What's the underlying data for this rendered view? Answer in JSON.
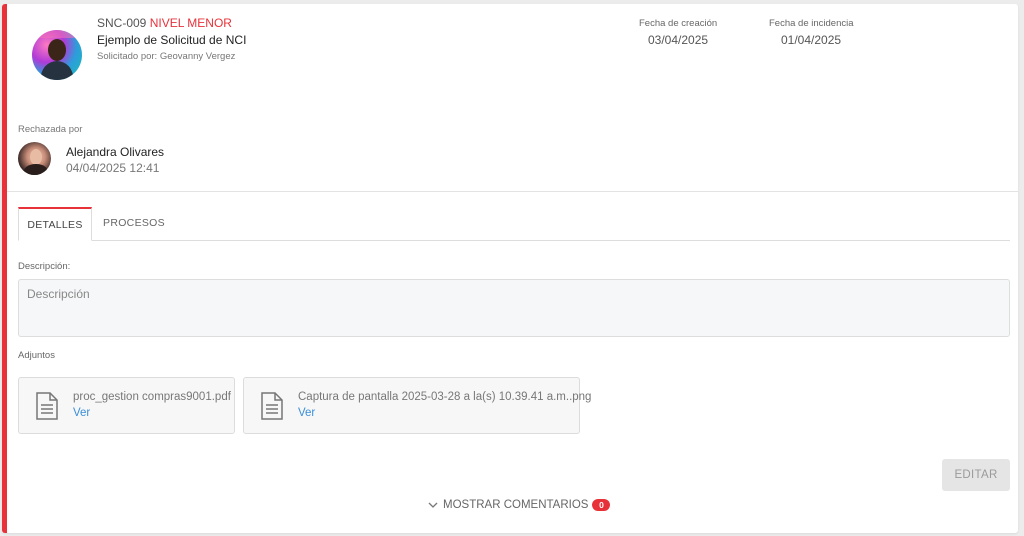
{
  "request": {
    "code": "SNC-009",
    "level": "NIVEL MENOR",
    "title": "Ejemplo de Solicitud de NCI",
    "requested_by": "Solicitado por: Geovanny Vergez"
  },
  "dates": {
    "created_label": "Fecha de creación",
    "created_value": "03/04/2025",
    "incident_label": "Fecha de incidencia",
    "incident_value": "01/04/2025"
  },
  "rejection": {
    "label": "Rechazada por",
    "name": "Alejandra Olivares",
    "datetime": "04/04/2025 12:41"
  },
  "tabs": [
    {
      "label": "DETALLES",
      "active": true
    },
    {
      "label": "PROCESOS",
      "active": false
    }
  ],
  "description": {
    "label": "Descripción:",
    "placeholder": "Descripción"
  },
  "attachments": {
    "label": "Adjuntos",
    "items": [
      {
        "name": "proc_gestion compras9001.pdf",
        "link": "Ver"
      },
      {
        "name": "Captura de pantalla 2025-03-28 a la(s) 10.39.41 a.m..png",
        "link": "Ver"
      }
    ]
  },
  "actions": {
    "edit_label": "EDITAR"
  },
  "comments": {
    "label": "MOSTRAR COMENTARIOS",
    "count": "0"
  },
  "colors": {
    "accent": "#e8323a",
    "link": "#3a8fd8"
  },
  "icons": {
    "file": "document-icon",
    "chevron": "chevron-down-icon"
  }
}
